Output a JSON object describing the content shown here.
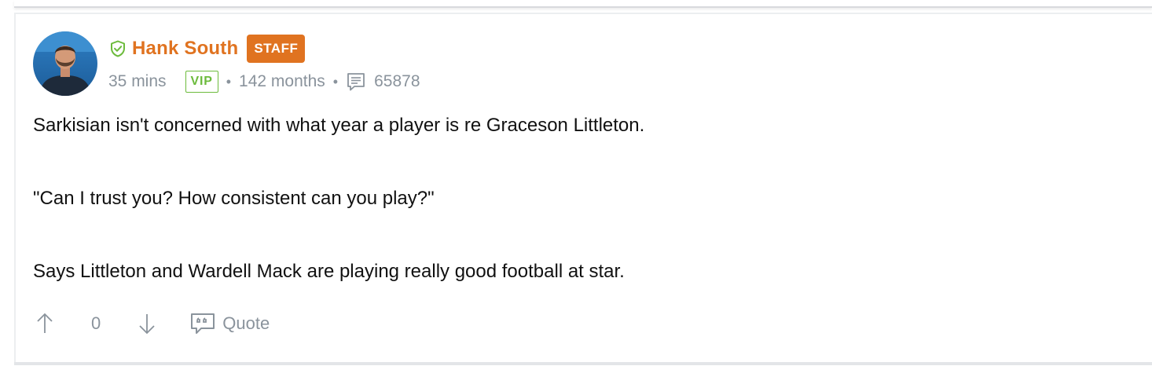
{
  "post": {
    "author": {
      "name": "Hank South",
      "role_badge": "STAFF",
      "avatar_icon": "avatar-photo"
    },
    "meta": {
      "time": "35 mins",
      "membership_badge": "VIP",
      "tenure": "142 months",
      "post_count": "65878"
    },
    "body": [
      "Sarkisian isn't concerned with what year a player is re Graceson Littleton.",
      "\"Can I trust you? How consistent can you play?\"",
      "Says Littleton and Wardell Mack are playing really good football at star."
    ],
    "actions": {
      "vote_count": "0",
      "quote_label": "Quote"
    }
  },
  "colors": {
    "staff_orange": "#e07320",
    "vip_green": "#6cbb3c",
    "meta_gray": "#8a939c"
  },
  "icons": [
    "shield-check-icon",
    "comment-count-icon",
    "upvote-arrow-icon",
    "downvote-arrow-icon",
    "quote-icon"
  ]
}
